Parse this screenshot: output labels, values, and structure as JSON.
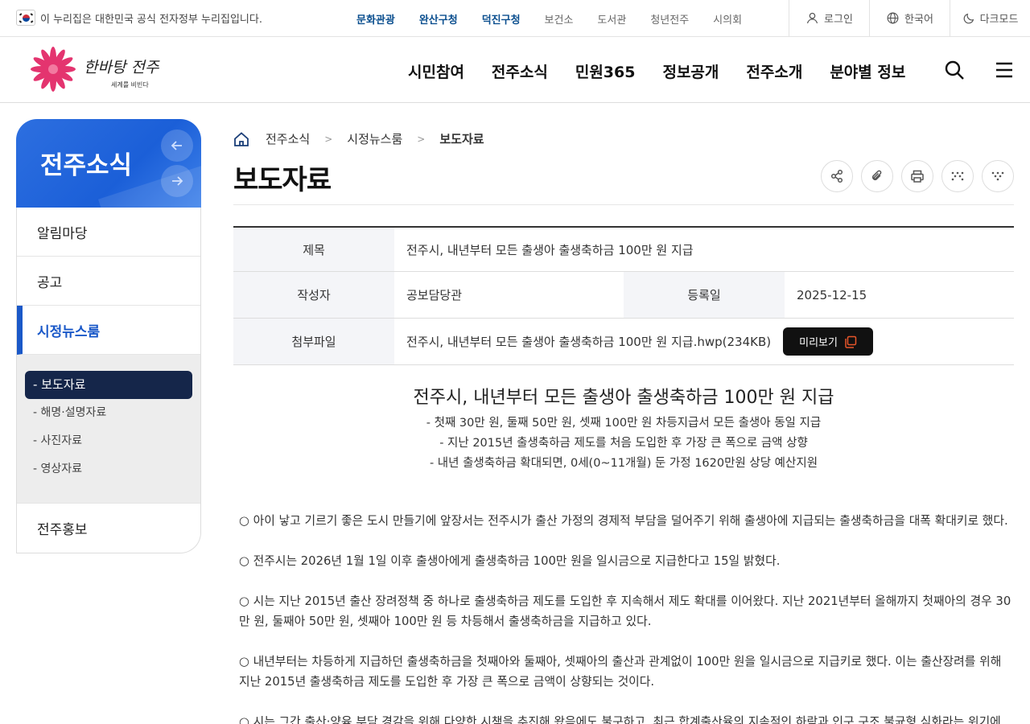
{
  "gov_bar": {
    "notice": "이 누리집은 대한민국 공식 전자정부 누리집입니다.",
    "links": [
      {
        "label": "문화관광",
        "highlight": true
      },
      {
        "label": "완산구청",
        "highlight": true
      },
      {
        "label": "덕진구청",
        "highlight": true
      },
      {
        "label": "보건소",
        "highlight": false
      },
      {
        "label": "도서관",
        "highlight": false
      },
      {
        "label": "청년전주",
        "highlight": false
      },
      {
        "label": "시의회",
        "highlight": false
      }
    ],
    "login": "로그인",
    "language": "한국어",
    "dark_mode": "다크모드"
  },
  "header": {
    "logo_text": "한바탕 전주",
    "logo_sub": "세계를 비빈다",
    "menu": [
      "시민참여",
      "전주소식",
      "민원365",
      "정보공개",
      "전주소개",
      "분야별 정보"
    ]
  },
  "sidebar": {
    "title": "전주소식",
    "items": [
      {
        "label": "알림마당"
      },
      {
        "label": "공고"
      },
      {
        "label": "시정뉴스룸"
      },
      {
        "label": "전주홍보"
      }
    ],
    "sub_items": [
      {
        "label": "- 보도자료"
      },
      {
        "label": "- 해명·설명자료"
      },
      {
        "label": "- 사진자료"
      },
      {
        "label": "- 영상자료"
      }
    ]
  },
  "breadcrumb": [
    "전주소식",
    "시정뉴스룸",
    "보도자료"
  ],
  "page_title": "보도자료",
  "info": {
    "title_label": "제목",
    "title_value": "전주시, 내년부터 모든 출생아 출생축하금 100만 원 지급",
    "author_label": "작성자",
    "author_value": "공보담당관",
    "date_label": "등록일",
    "date_value": "2025-12-15",
    "file_label": "첨부파일",
    "file_value": "전주시, 내년부터 모든 출생아 출생축하금 100만 원 지급.hwp(234KB)",
    "preview_label": "미리보기"
  },
  "article": {
    "title": "전주시, 내년부터 모든 출생아 출생축하금 100만 원 지급",
    "subtitles": [
      "- 첫째 30만 원, 둘째 50만 원, 셋째 100만 원 차등지급서 모든 출생아 동일 지급",
      "- 지난 2015년 출생축하금 제도를 처음 도입한 후 가장 큰 폭으로 금액 상향",
      "- 내년 출생축하금 확대되면, 0세(0~11개월) 둔 가정 1620만원 상당 예산지원"
    ],
    "paragraphs": [
      "○ 아이 낳고 기르기 좋은 도시 만들기에 앞장서는 전주시가 출산 가정의 경제적 부담을 덜어주기 위해 출생아에 지급되는 출생축하금을 대폭 확대키로 했다.",
      "○ 전주시는 2026년 1월 1일 이후 출생아에게 출생축하금 100만 원을 일시금으로 지급한다고 15일 밝혔다.",
      "○ 시는 지난 2015년 출산 장려정책 중 하나로 출생축하금 제도를 도입한 후 지속해서 제도 확대를 이어왔다. 지난 2021년부터 올해까지 첫째아의 경우 30만 원, 둘째아 50만 원, 셋째아 100만 원 등 차등해서 출생축하금을 지급하고 있다.",
      "○ 내년부터는 차등하게 지급하던 출생축하금을 첫째아와 둘째아, 셋째아의 출산과 관계없이 100만 원을 일시금으로 지급키로 했다. 이는 출산장려를 위해 지난 2015년 출생축하금 제도를 도입한 후 가장 큰 폭으로 금액이 상향되는 것이다.",
      "○ 시는 그간 출산·양육 부담 경감을 위해 다양한 시책을 추진해 왔음에도 불구하고, 최근 합계출산율의 지속적인 하락과 인구 구조 불균형 심화라는 위기에"
    ]
  },
  "colors": {
    "accent": "#1a58c8",
    "sub_active": "#15264a",
    "link_highlight": "#0b4f8f"
  }
}
